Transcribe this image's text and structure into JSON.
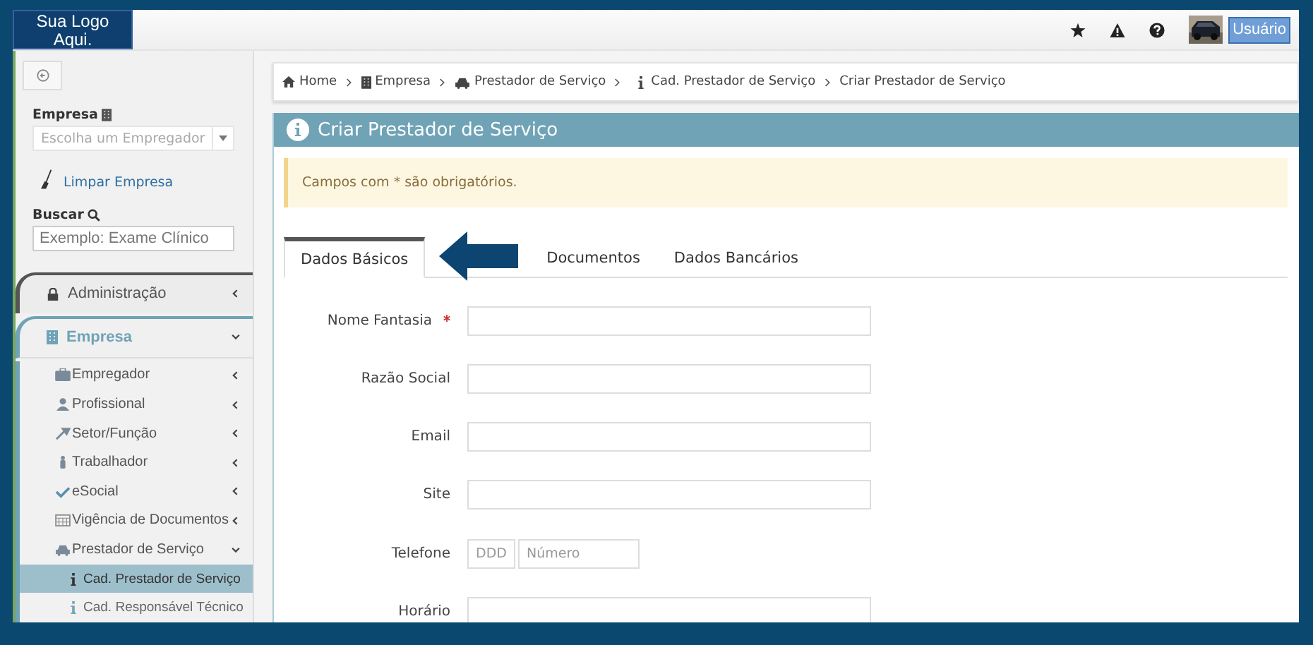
{
  "logo": {
    "text": "Sua Logo Aqui."
  },
  "topbar": {
    "user_button": "Usuário"
  },
  "sidebar": {
    "empresa_label": "Empresa",
    "empresa_select": {
      "placeholder": "Escolha um Empregador"
    },
    "clear_link": "Limpar Empresa",
    "search_label": "Buscar",
    "search": {
      "placeholder": "Exemplo: Exame Clínico"
    },
    "menu": [
      {
        "label": "Administração",
        "expanded": false
      },
      {
        "label": "Empresa",
        "expanded": true,
        "children": [
          {
            "label": "Empregador",
            "expanded": false
          },
          {
            "label": "Profissional",
            "expanded": false
          },
          {
            "label": "Setor/Função",
            "expanded": false
          },
          {
            "label": "Trabalhador",
            "expanded": false
          },
          {
            "label": "eSocial",
            "expanded": false
          },
          {
            "label": "Vigência de Documentos",
            "expanded": false
          },
          {
            "label": "Prestador de Serviço",
            "expanded": true,
            "children": [
              {
                "label": "Cad. Prestador de Serviço",
                "selected": true
              },
              {
                "label": "Cad. Responsável Técnico",
                "selected": false
              }
            ]
          }
        ]
      }
    ]
  },
  "breadcrumb": [
    "Home",
    "Empresa",
    "Prestador de Serviço",
    "Cad. Prestador de Serviço",
    "Criar Prestador de Serviço"
  ],
  "panel": {
    "title": "Criar Prestador de Serviço",
    "alert": "Campos com * são obrigatórios.",
    "tabs": [
      {
        "label": "Dados Básicos",
        "selected": true
      },
      {
        "label": "Documentos",
        "selected": false
      },
      {
        "label": "Dados Bancários",
        "selected": false
      }
    ],
    "fields": [
      {
        "kind": "text",
        "label": "Nome Fantasia",
        "required": true
      },
      {
        "kind": "text",
        "label": "Razão Social",
        "required": false
      },
      {
        "kind": "text",
        "label": "Email",
        "required": false
      },
      {
        "kind": "text",
        "label": "Site",
        "required": false
      },
      {
        "kind": "phone",
        "label": "Telefone",
        "required": false,
        "placeholders": [
          "DDD",
          "Número"
        ]
      },
      {
        "kind": "text",
        "label": "Horário",
        "required": false
      }
    ]
  }
}
